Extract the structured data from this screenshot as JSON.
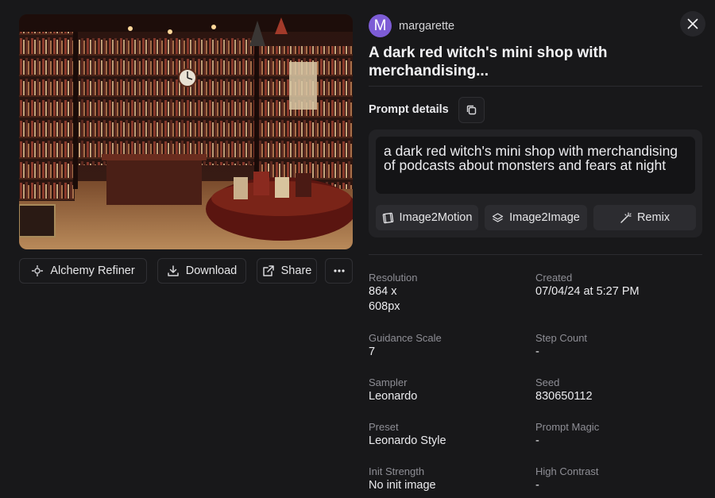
{
  "user": {
    "initial": "M",
    "name": "margarette"
  },
  "title": "A dark red witch's mini shop with merchandising...",
  "prompt": {
    "heading": "Prompt details",
    "text": "a dark red witch's mini shop with merchandising of podcasts about monsters and fears at night",
    "buttons": {
      "image2motion": "Image2Motion",
      "image2image": "Image2Image",
      "remix": "Remix"
    }
  },
  "actions": {
    "alchemy_refiner": "Alchemy Refiner",
    "download": "Download",
    "share": "Share"
  },
  "details": {
    "resolution": {
      "label": "Resolution",
      "value_line1": "864 x",
      "value_line2": "608px"
    },
    "created": {
      "label": "Created",
      "value": "07/04/24 at 5:27 PM"
    },
    "guidance_scale": {
      "label": "Guidance Scale",
      "value": "7"
    },
    "step_count": {
      "label": "Step Count",
      "value": "-"
    },
    "sampler": {
      "label": "Sampler",
      "value": "Leonardo"
    },
    "seed": {
      "label": "Seed",
      "value": "830650112"
    },
    "preset": {
      "label": "Preset",
      "value": "Leonardo Style"
    },
    "prompt_magic": {
      "label": "Prompt Magic",
      "value": "-"
    },
    "init_strength": {
      "label": "Init Strength",
      "value": "No init image"
    },
    "high_contrast": {
      "label": "High Contrast",
      "value": "-"
    }
  },
  "colors": {
    "background": "#18181a",
    "avatar": "#7d5cd6",
    "panel": "#222225",
    "button": "#2c2c30"
  }
}
